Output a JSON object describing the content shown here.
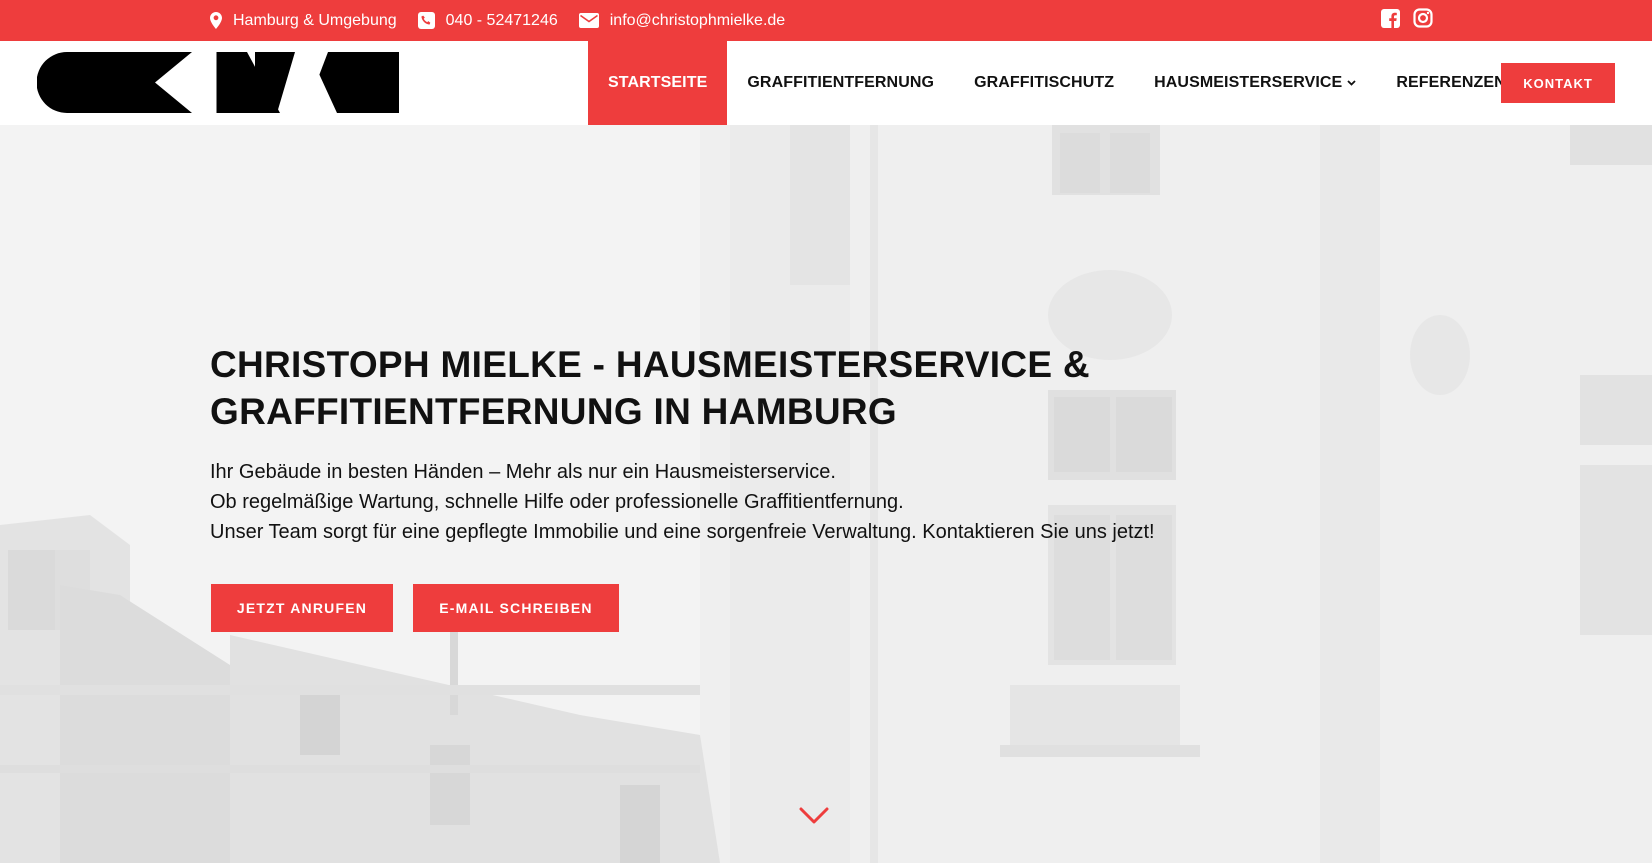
{
  "topbar": {
    "location": "Hamburg & Umgebung",
    "phone": "040 - 52471246",
    "email": "info@christophmielke.de",
    "social": [
      "facebook-icon",
      "instagram-icon"
    ]
  },
  "header": {
    "logo_alt": "CMM logo",
    "nav": [
      {
        "label": "STARTSEITE",
        "active": true
      },
      {
        "label": "GRAFFITIENTFERNUNG",
        "active": false
      },
      {
        "label": "GRAFFITISCHUTZ",
        "active": false
      },
      {
        "label": "HAUSMEISTERSERVICE",
        "active": false,
        "has_dropdown": true
      },
      {
        "label": "REFERENZEN",
        "active": false
      }
    ],
    "cta_label": "KONTAKT"
  },
  "hero": {
    "title_line1": "CHRISTOPH MIELKE - HAUSMEISTERSERVICE &",
    "title_line2": "GRAFFITIENTFERNUNG IN HAMBURG",
    "text_line1": "Ihr Gebäude in besten Händen – Mehr als nur ein Hausmeisterservice.",
    "text_line2": "Ob regelmäßige Wartung, schnelle Hilfe oder professionelle Graffitientfernung.",
    "text_line3": "Unser Team sorgt für eine gepflegte Immobilie und eine sorgenfreie Verwaltung. Kontaktieren Sie uns jetzt!",
    "button_call": "JETZT ANRUFEN",
    "button_mail": "E-MAIL SCHREIBEN"
  },
  "colors": {
    "accent": "#ee3d3d",
    "text": "#111111",
    "hero_background": "#ececec"
  }
}
